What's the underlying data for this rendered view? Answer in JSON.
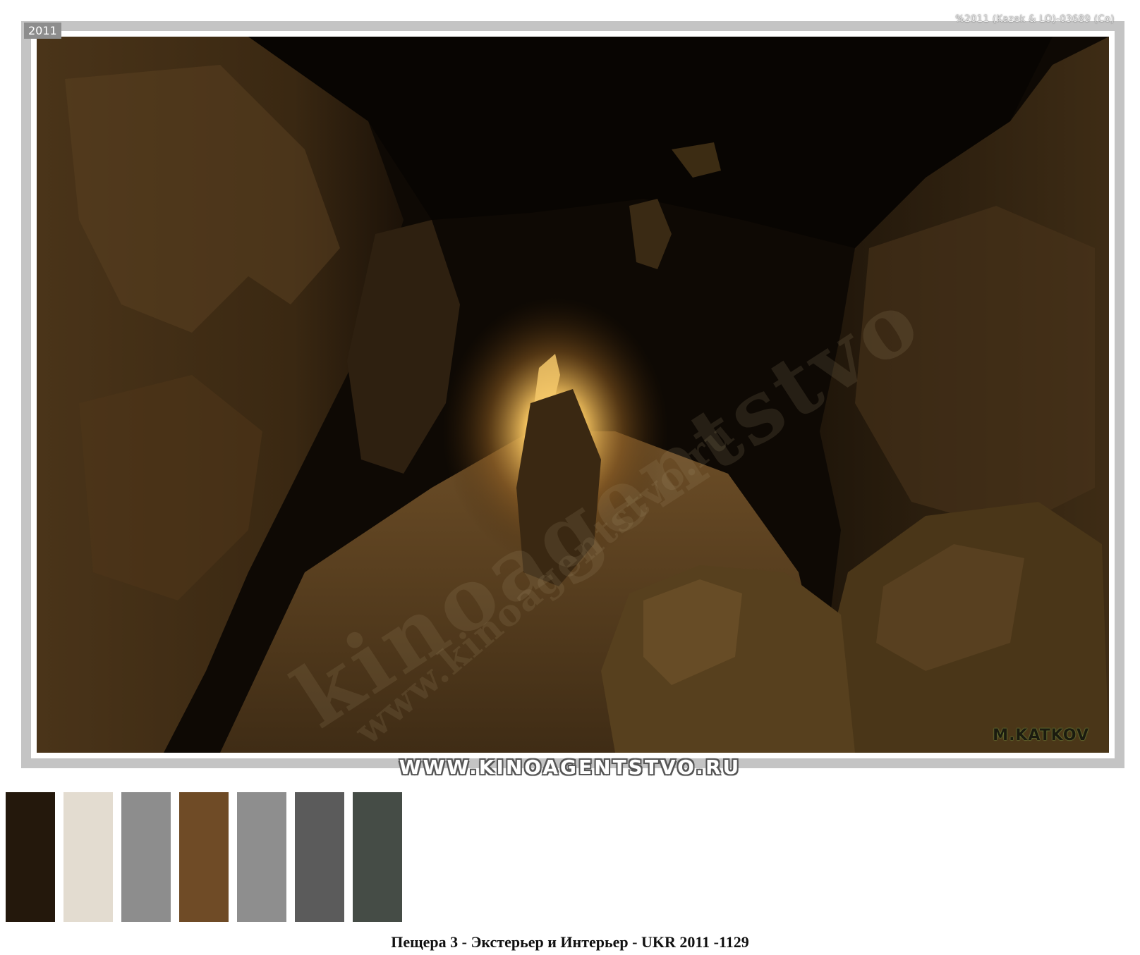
{
  "year_tag": "2011",
  "copyright": "%2011 (Kazek & LO)-03689 (Co)",
  "site_banner": "WWW.KINOAGENTSTVO.RU",
  "author_mark": "M.KATKOV",
  "watermark_big": "kinoagentstvo",
  "watermark_small": "www.kinoagentstvo.ru",
  "photo": {
    "subject": "cave"
  },
  "palette": [
    "#24180c",
    "#e3dcd0",
    "#8d8d8d",
    "#6f4b26",
    "#8e8e8e",
    "#5b5b5b",
    "#454c46"
  ],
  "caption": "Пещера 3 - Экстерьер и Интерьер - UKR 2011 -1129"
}
